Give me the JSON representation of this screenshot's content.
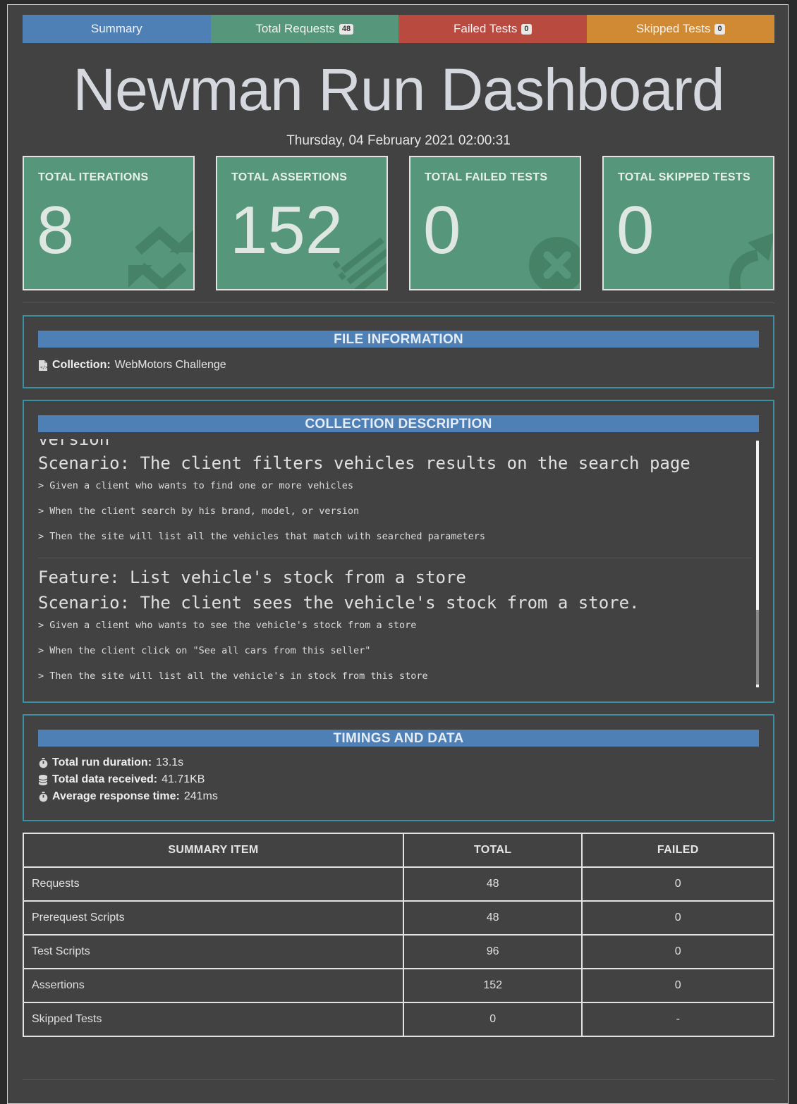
{
  "tabs": [
    {
      "label": "Summary",
      "badge": null
    },
    {
      "label": "Total Requests",
      "badge": "48"
    },
    {
      "label": "Failed Tests",
      "badge": "0"
    },
    {
      "label": "Skipped Tests",
      "badge": "0"
    }
  ],
  "header": {
    "title": "Newman Run Dashboard",
    "date": "Thursday, 04 February 2021 02:00:31"
  },
  "cards": [
    {
      "label": "TOTAL ITERATIONS",
      "value": "8",
      "icon": "refresh-icon"
    },
    {
      "label": "TOTAL ASSERTIONS",
      "value": "152",
      "icon": "list-icon"
    },
    {
      "label": "TOTAL FAILED TESTS",
      "value": "0",
      "icon": "close-circle-icon"
    },
    {
      "label": "TOTAL SKIPPED TESTS",
      "value": "0",
      "icon": "share-arrow-icon"
    }
  ],
  "file_info": {
    "heading": "FILE INFORMATION",
    "collection_label": "Collection:",
    "collection_value": "WebMotors Challenge"
  },
  "description": {
    "heading": "COLLECTION DESCRIPTION",
    "cut_line": "version",
    "block1": {
      "scenario": "Scenario: The client filters vehicles results on the search page",
      "steps": [
        "> Given a client who wants to find one or more vehicles",
        "> When the client search by his brand, model, or version",
        "> Then the site will list all the vehicles that match with searched parameters"
      ]
    },
    "block2": {
      "feature": "Feature: List vehicle's stock from a store",
      "scenario": "Scenario: The client sees the vehicle's stock from a store.",
      "steps": [
        "> Given a client who wants to see the vehicle's stock from a store",
        "> When the client click on \"See all cars from this seller\"",
        "> Then the site will list all the vehicle's in stock from this store"
      ]
    }
  },
  "timings": {
    "heading": "TIMINGS AND DATA",
    "duration_label": "Total run duration:",
    "duration_value": "13.1s",
    "data_label": "Total data received:",
    "data_value": "41.71KB",
    "avg_label": "Average response time:",
    "avg_value": "241ms"
  },
  "summary_table": {
    "headers": [
      "SUMMARY ITEM",
      "TOTAL",
      "FAILED"
    ],
    "rows": [
      [
        "Requests",
        "48",
        "0"
      ],
      [
        "Prerequest Scripts",
        "48",
        "0"
      ],
      [
        "Test Scripts",
        "96",
        "0"
      ],
      [
        "Assertions",
        "152",
        "0"
      ],
      [
        "Skipped Tests",
        "0",
        "-"
      ]
    ]
  },
  "colors": {
    "summary_tab": "#4f80b5",
    "requests_tab": "#56967a",
    "failed_tab": "#b84a40",
    "skipped_tab": "#d08a34",
    "card_bg": "#56967a",
    "panel_border": "#3a8fa0"
  }
}
